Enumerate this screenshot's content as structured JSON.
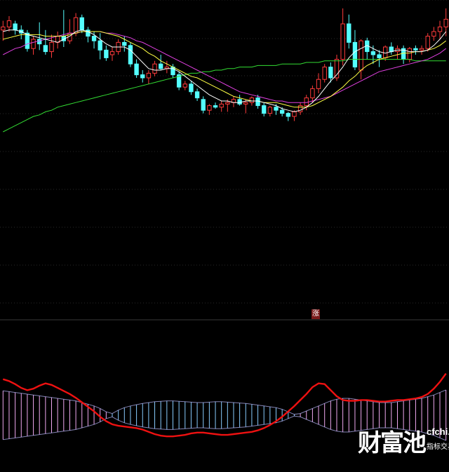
{
  "colors": {
    "background": "#000000",
    "grid": "#2a2a2a",
    "separator": "#3a3a3a",
    "candle_up": "#ff3b3b",
    "candle_down": "#54ffff",
    "ma_short": "#ffffff",
    "ma_mid": "#ffff44",
    "ma_long": "#e040e0",
    "ma_slow": "#33dd33",
    "osc_line": "#ee1111",
    "bar_pos": "#f0a8f0",
    "bar_neg": "#88ccff"
  },
  "signal_label": "涨",
  "watermark": {
    "brand": "财富池",
    "url": "cfchi.com",
    "tagline": "指标交易平台"
  },
  "chart_data": [
    {
      "type": "candlestick",
      "ylim": [
        0,
        100
      ],
      "grid": true,
      "candles": [
        {
          "o": 86,
          "h": 92,
          "l": 79,
          "c": 88
        },
        {
          "o": 88,
          "h": 95,
          "l": 85,
          "c": 92
        },
        {
          "o": 90,
          "h": 92,
          "l": 83,
          "c": 86
        },
        {
          "o": 86,
          "h": 89,
          "l": 80,
          "c": 84
        },
        {
          "o": 84,
          "h": 86,
          "l": 72,
          "c": 74
        },
        {
          "o": 74,
          "h": 82,
          "l": 70,
          "c": 80
        },
        {
          "o": 80,
          "h": 91,
          "l": 73,
          "c": 77
        },
        {
          "o": 76,
          "h": 86,
          "l": 70,
          "c": 72
        },
        {
          "o": 72,
          "h": 83,
          "l": 68,
          "c": 78
        },
        {
          "o": 78,
          "h": 85,
          "l": 74,
          "c": 82
        },
        {
          "o": 82,
          "h": 99,
          "l": 75,
          "c": 79
        },
        {
          "o": 79,
          "h": 93,
          "l": 77,
          "c": 84
        },
        {
          "o": 84,
          "h": 97,
          "l": 82,
          "c": 94
        },
        {
          "o": 94,
          "h": 96,
          "l": 84,
          "c": 86
        },
        {
          "o": 86,
          "h": 88,
          "l": 78,
          "c": 82
        },
        {
          "o": 82,
          "h": 85,
          "l": 74,
          "c": 79
        },
        {
          "o": 79,
          "h": 84,
          "l": 67,
          "c": 73
        },
        {
          "o": 73,
          "h": 76,
          "l": 66,
          "c": 68
        },
        {
          "o": 70,
          "h": 75,
          "l": 66,
          "c": 72
        },
        {
          "o": 72,
          "h": 80,
          "l": 70,
          "c": 78
        },
        {
          "o": 78,
          "h": 82,
          "l": 72,
          "c": 76
        },
        {
          "o": 76,
          "h": 78,
          "l": 62,
          "c": 64
        },
        {
          "o": 64,
          "h": 67,
          "l": 55,
          "c": 57
        },
        {
          "o": 57,
          "h": 60,
          "l": 52,
          "c": 55
        },
        {
          "o": 55,
          "h": 60,
          "l": 51,
          "c": 58
        },
        {
          "o": 58,
          "h": 66,
          "l": 56,
          "c": 64
        },
        {
          "o": 64,
          "h": 70,
          "l": 60,
          "c": 61
        },
        {
          "o": 61,
          "h": 66,
          "l": 58,
          "c": 62
        },
        {
          "o": 62,
          "h": 64,
          "l": 55,
          "c": 57
        },
        {
          "o": 57,
          "h": 59,
          "l": 47,
          "c": 49
        },
        {
          "o": 49,
          "h": 53,
          "l": 47,
          "c": 51
        },
        {
          "o": 51,
          "h": 53,
          "l": 44,
          "c": 46
        },
        {
          "o": 46,
          "h": 48,
          "l": 40,
          "c": 42
        },
        {
          "o": 41,
          "h": 43,
          "l": 32,
          "c": 34
        },
        {
          "o": 34,
          "h": 38,
          "l": 31,
          "c": 37
        },
        {
          "o": 37,
          "h": 39,
          "l": 35,
          "c": 36
        },
        {
          "o": 36,
          "h": 40,
          "l": 33,
          "c": 38
        },
        {
          "o": 38,
          "h": 41,
          "l": 33,
          "c": 39
        },
        {
          "o": 39,
          "h": 43,
          "l": 36,
          "c": 41
        },
        {
          "o": 41,
          "h": 44,
          "l": 37,
          "c": 38
        },
        {
          "o": 38,
          "h": 41,
          "l": 32,
          "c": 39
        },
        {
          "o": 39,
          "h": 43,
          "l": 37,
          "c": 42
        },
        {
          "o": 42,
          "h": 44,
          "l": 35,
          "c": 37
        },
        {
          "o": 37,
          "h": 39,
          "l": 30,
          "c": 32
        },
        {
          "o": 32,
          "h": 37,
          "l": 30,
          "c": 36
        },
        {
          "o": 36,
          "h": 38,
          "l": 31,
          "c": 34
        },
        {
          "o": 34,
          "h": 36,
          "l": 30,
          "c": 32
        },
        {
          "o": 32,
          "h": 33,
          "l": 27,
          "c": 30
        },
        {
          "o": 30,
          "h": 34,
          "l": 27,
          "c": 33
        },
        {
          "o": 33,
          "h": 39,
          "l": 31,
          "c": 37
        },
        {
          "o": 37,
          "h": 44,
          "l": 34,
          "c": 42
        },
        {
          "o": 42,
          "h": 50,
          "l": 39,
          "c": 48
        },
        {
          "o": 48,
          "h": 58,
          "l": 45,
          "c": 54
        },
        {
          "o": 54,
          "h": 64,
          "l": 52,
          "c": 62
        },
        {
          "o": 62,
          "h": 65,
          "l": 52,
          "c": 55
        },
        {
          "o": 55,
          "h": 70,
          "l": 53,
          "c": 67
        },
        {
          "o": 67,
          "h": 100,
          "l": 63,
          "c": 90
        },
        {
          "o": 90,
          "h": 96,
          "l": 74,
          "c": 78
        },
        {
          "o": 78,
          "h": 86,
          "l": 60,
          "c": 62
        },
        {
          "o": 60,
          "h": 80,
          "l": 54,
          "c": 79
        },
        {
          "o": 79,
          "h": 81,
          "l": 67,
          "c": 72
        },
        {
          "o": 72,
          "h": 76,
          "l": 64,
          "c": 70
        },
        {
          "o": 70,
          "h": 73,
          "l": 62,
          "c": 68
        },
        {
          "o": 68,
          "h": 76,
          "l": 66,
          "c": 75
        },
        {
          "o": 75,
          "h": 78,
          "l": 70,
          "c": 72
        },
        {
          "o": 72,
          "h": 76,
          "l": 67,
          "c": 74
        },
        {
          "o": 74,
          "h": 76,
          "l": 64,
          "c": 67
        },
        {
          "o": 67,
          "h": 75,
          "l": 65,
          "c": 74
        },
        {
          "o": 74,
          "h": 76,
          "l": 70,
          "c": 73
        },
        {
          "o": 73,
          "h": 76,
          "l": 70,
          "c": 74
        },
        {
          "o": 74,
          "h": 84,
          "l": 72,
          "c": 82
        },
        {
          "o": 82,
          "h": 88,
          "l": 79,
          "c": 85
        },
        {
          "o": 85,
          "h": 92,
          "l": 80,
          "c": 88
        },
        {
          "o": 88,
          "h": 100,
          "l": 82,
          "c": 93
        }
      ],
      "ma_short": [
        85,
        86,
        86,
        85,
        83,
        82,
        81,
        80,
        79,
        78,
        80,
        82,
        85,
        86,
        85,
        83,
        80,
        77,
        75,
        75,
        75,
        73,
        69,
        65,
        61,
        60,
        60,
        61,
        61,
        59,
        56,
        53,
        50,
        47,
        44,
        42,
        40,
        40,
        39,
        39,
        40,
        40,
        40,
        39,
        38,
        37,
        35,
        34,
        33,
        34,
        36,
        39,
        43,
        48,
        53,
        57,
        62,
        68,
        72,
        74,
        76,
        74,
        72,
        71,
        72,
        73,
        73,
        72,
        72,
        72,
        73,
        76,
        80,
        85
      ],
      "ma_mid": [
        80,
        81,
        82,
        83,
        83,
        83,
        83,
        82,
        82,
        82,
        82,
        83,
        84,
        85,
        85,
        85,
        85,
        84,
        83,
        82,
        80,
        78,
        76,
        74,
        71,
        69,
        66,
        64,
        62,
        60,
        58,
        56,
        55,
        53,
        51,
        49,
        47,
        45,
        43,
        42,
        41,
        40,
        40,
        39,
        39,
        39,
        38,
        37,
        36,
        36,
        36,
        37,
        39,
        41,
        43,
        46,
        49,
        53,
        56,
        60,
        63,
        65,
        67,
        68,
        69,
        70,
        71,
        71,
        72,
        72,
        73,
        74,
        76,
        79
      ],
      "ma_long": [
        70,
        72,
        74,
        75,
        77,
        78,
        79,
        80,
        81,
        82,
        83,
        84,
        84,
        85,
        85,
        85,
        85,
        84,
        84,
        83,
        82,
        81,
        79,
        78,
        76,
        74,
        72,
        70,
        68,
        66,
        64,
        62,
        60,
        58,
        56,
        54,
        52,
        50,
        48,
        46,
        45,
        44,
        43,
        42,
        41,
        40,
        40,
        39,
        39,
        39,
        39,
        40,
        41,
        42,
        43,
        45,
        47,
        49,
        51,
        53,
        55,
        57,
        59,
        60,
        61,
        62,
        63,
        64,
        65,
        66,
        67,
        69,
        71,
        74
      ],
      "ma_slow": [
        20,
        22,
        24,
        26,
        28,
        30,
        31,
        33,
        34,
        36,
        37,
        38,
        39,
        40,
        41,
        42,
        43,
        44,
        45,
        46,
        47,
        48,
        49,
        50,
        51,
        52,
        53,
        54,
        55,
        56,
        57,
        58,
        58,
        59,
        59,
        60,
        60,
        61,
        61,
        62,
        62,
        62,
        63,
        63,
        63,
        63,
        64,
        64,
        64,
        64,
        65,
        65,
        65,
        66,
        66,
        66,
        66,
        67,
        67,
        67,
        67,
        67,
        67,
        67,
        67,
        67,
        67,
        67,
        66,
        66,
        66,
        66,
        66,
        66
      ]
    },
    {
      "type": "bar",
      "ylim": [
        -100,
        100
      ],
      "grid": false,
      "x_count": 74,
      "bar_values": [
        58,
        56,
        54,
        52,
        50,
        48,
        46,
        44,
        42,
        40,
        38,
        36,
        34,
        30,
        26,
        22,
        16,
        8,
        -4,
        -12,
        -18,
        -22,
        -25,
        -28,
        -30,
        -32,
        -33,
        -34,
        -34,
        -33,
        -32,
        -31,
        -30,
        -30,
        -31,
        -32,
        -32,
        -31,
        -30,
        -29,
        -28,
        -26,
        -24,
        -22,
        -20,
        -18,
        -14,
        -8,
        -2,
        4,
        10,
        16,
        22,
        28,
        34,
        38,
        40,
        40,
        38,
        36,
        34,
        32,
        30,
        30,
        30,
        32,
        34,
        36,
        38,
        40,
        44,
        48,
        54,
        60
      ],
      "line_values": [
        95,
        90,
        82,
        72,
        66,
        70,
        78,
        84,
        80,
        72,
        64,
        56,
        46,
        34,
        22,
        10,
        -4,
        -16,
        -24,
        -28,
        -30,
        -32,
        -34,
        -38,
        -44,
        -50,
        -54,
        -56,
        -56,
        -54,
        -52,
        -48,
        -46,
        -46,
        -48,
        -50,
        -52,
        -52,
        -50,
        -48,
        -46,
        -44,
        -40,
        -34,
        -26,
        -16,
        -4,
        10,
        24,
        40,
        56,
        74,
        84,
        82,
        66,
        50,
        40,
        38,
        38,
        40,
        40,
        38,
        36,
        36,
        38,
        40,
        40,
        42,
        44,
        48,
        56,
        70,
        88,
        110
      ]
    }
  ]
}
